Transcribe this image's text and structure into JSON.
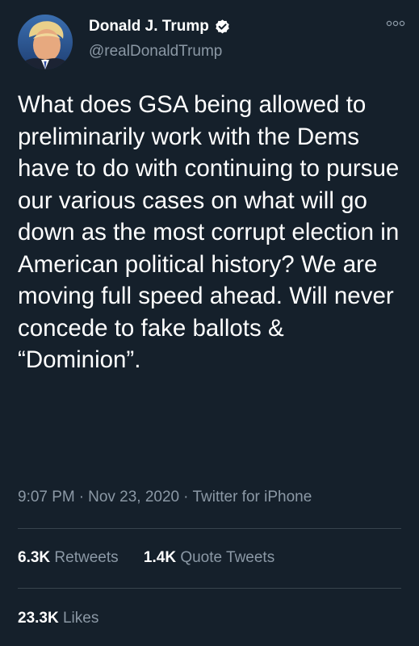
{
  "author": {
    "name": "Donald J. Trump",
    "handle": "@realDonaldTrump",
    "verified": true,
    "avatar_icon": "profile-photo"
  },
  "tweet": {
    "text": "What does GSA being allowed to preliminarily work with the Dems have to do with continuing to pursue our various cases on what will go down as the most corrupt election in American political history? We are moving full speed ahead. Will never concede to fake ballots & “Dominion”.",
    "time": "9:07 PM",
    "date": "Nov 23, 2020",
    "source": "Twitter for iPhone",
    "separator": "·"
  },
  "stats": {
    "retweets_count": "6.3K",
    "retweets_label": "Retweets",
    "quote_count": "1.4K",
    "quote_label": "Quote Tweets",
    "likes_count": "23.3K",
    "likes_label": "Likes"
  },
  "colors": {
    "background": "#15202b",
    "text": "#ffffff",
    "secondary": "#8b98a5",
    "divider": "#38444d",
    "verified": "#ffffff"
  },
  "icons": {
    "more": "more-icon",
    "verified": "verified-badge-icon"
  }
}
